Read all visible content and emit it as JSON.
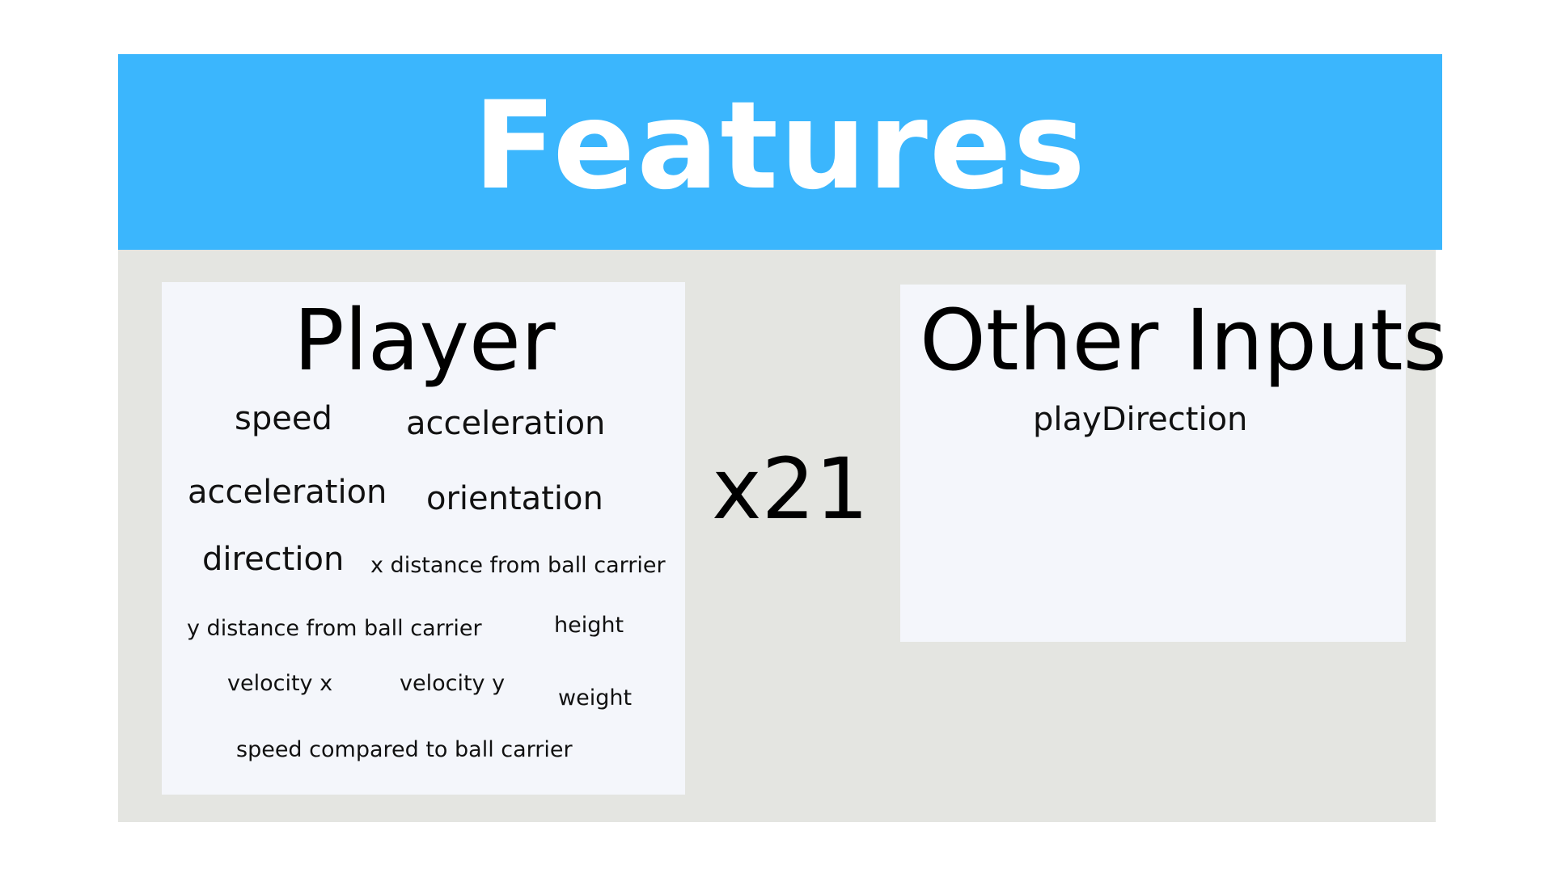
{
  "title": "Features",
  "player_card": {
    "heading": "Player",
    "features": [
      "speed",
      "acceleration",
      "acceleration",
      "orientation",
      "direction",
      "x distance from ball carrier",
      "y distance from ball carrier",
      "height",
      "velocity x",
      "velocity y",
      "weight",
      "speed compared to ball carrier"
    ]
  },
  "multiplier": "x21",
  "other_card": {
    "heading": "Other Inputs",
    "features": [
      "playDirection"
    ]
  },
  "colors": {
    "title_bar": "#3bb6fd",
    "panel": "#e4e5e1",
    "card": "#f4f6fb"
  }
}
